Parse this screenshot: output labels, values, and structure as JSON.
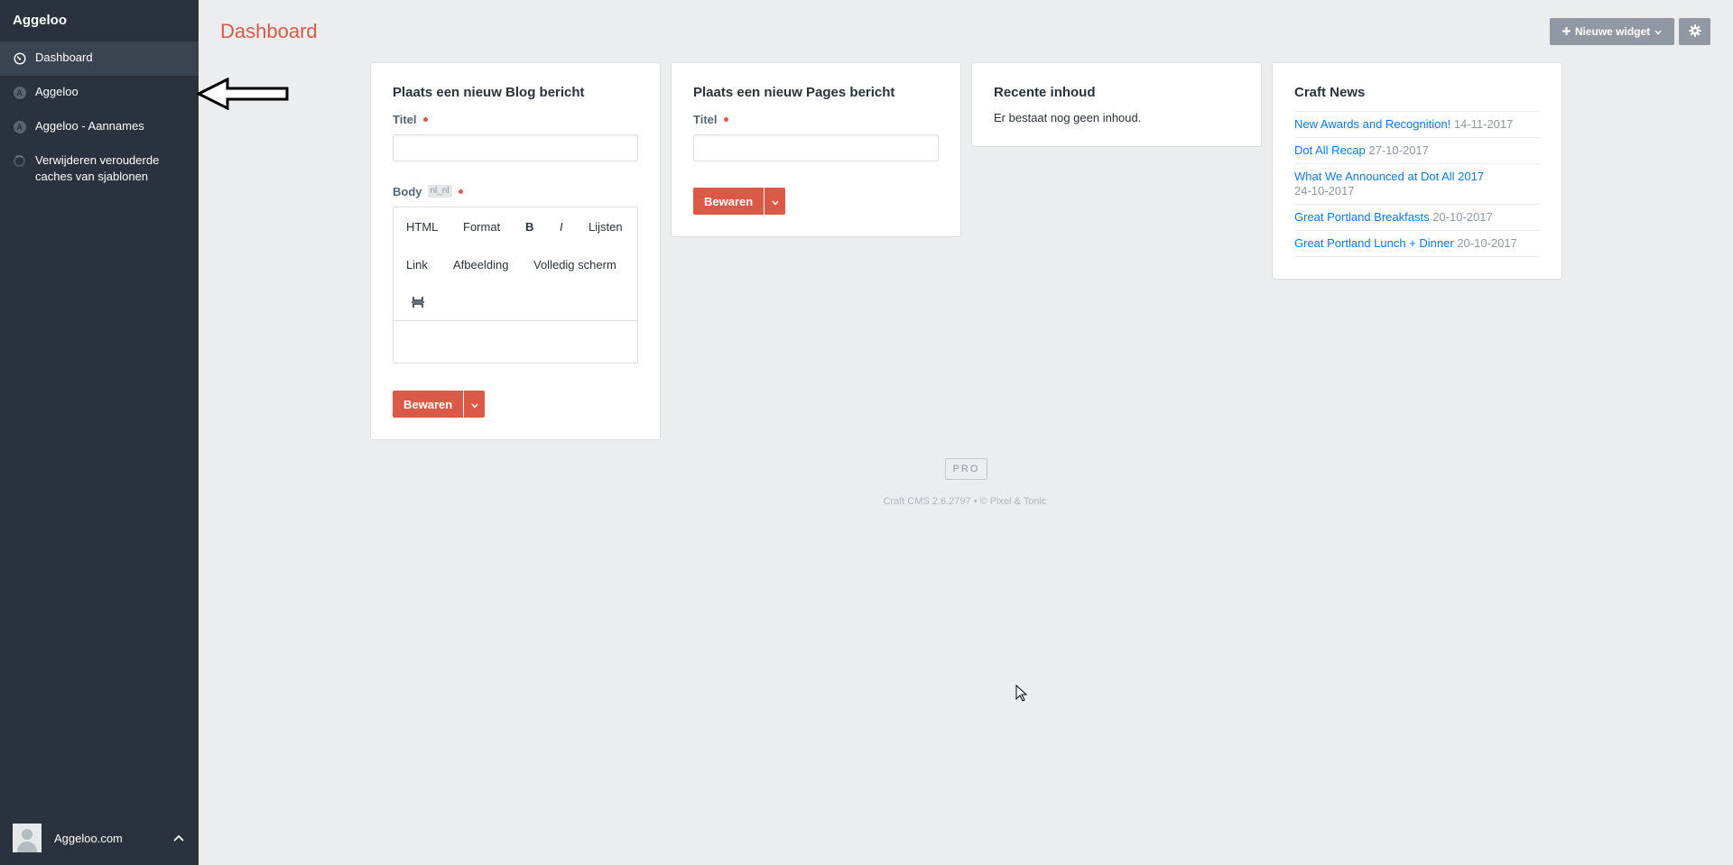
{
  "sidebar": {
    "site_name": "Aggeloo",
    "items": [
      {
        "label": "Dashboard",
        "icon": "gauge-icon"
      },
      {
        "label": "Aggeloo",
        "icon": "letter-a-icon",
        "icon_letter": "A"
      },
      {
        "label": "Aggeloo - Aannames",
        "icon": "letter-a-icon",
        "icon_letter": "A"
      },
      {
        "label": "Verwijderen verouderde caches van sjablonen",
        "icon": "spinner-icon"
      }
    ],
    "account_name": "Aggeloo.com"
  },
  "header": {
    "title": "Dashboard",
    "new_widget_label": "Nieuwe widget"
  },
  "widgets": {
    "blog": {
      "title": "Plaats een nieuw Blog bericht",
      "title_field_label": "Titel",
      "body_label": "Body",
      "body_locale": "nl_nl",
      "toolbar": [
        "HTML",
        "Format",
        "B",
        "I",
        "Lijsten",
        "Link",
        "Afbeelding",
        "Volledig scherm"
      ],
      "save_label": "Bewaren"
    },
    "pages": {
      "title": "Plaats een nieuw Pages bericht",
      "title_field_label": "Titel",
      "save_label": "Bewaren"
    },
    "recent": {
      "title": "Recente inhoud",
      "empty_text": "Er bestaat nog geen inhoud."
    },
    "news": {
      "title": "Craft News",
      "items": [
        {
          "title": "New Awards and Recognition!",
          "date": "14-11-2017"
        },
        {
          "title": "Dot All Recap",
          "date": "27-10-2017"
        },
        {
          "title": "What We Announced at Dot All 2017",
          "date": "24-10-2017"
        },
        {
          "title": "Great Portland Breakfasts",
          "date": "20-10-2017"
        },
        {
          "title": "Great Portland Lunch + Dinner",
          "date": "20-10-2017"
        }
      ]
    }
  },
  "footer": {
    "edition": "PRO",
    "credits": "Craft CMS 2.6.2797  •  © Pixel & Tonic"
  },
  "colors": {
    "sidebar_bg": "#29323d",
    "accent": "#da5a47",
    "link": "#0d78f2",
    "page_bg": "#ebedef"
  }
}
